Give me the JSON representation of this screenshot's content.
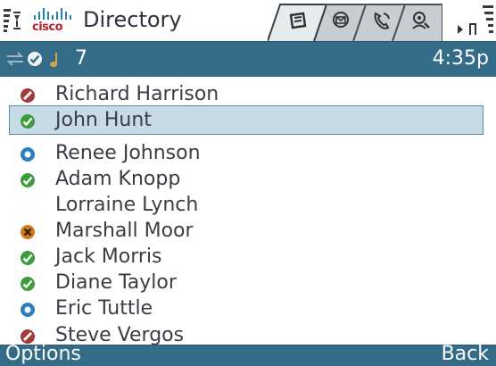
{
  "header": {
    "app_title": "Directory",
    "brand": "cisco",
    "tabs": [
      {
        "name": "contacts-card-icon",
        "active": true
      },
      {
        "name": "messages-icon",
        "active": false
      },
      {
        "name": "phone-call-icon",
        "active": false
      },
      {
        "name": "presence-search-icon",
        "active": false
      }
    ]
  },
  "status_bar": {
    "count": "7",
    "time": "4:35p",
    "icons": [
      "transfer-arrows-icon",
      "available-check-icon",
      "music-note-icon"
    ]
  },
  "contacts": [
    {
      "name": "Richard Harrison",
      "status": "busy",
      "selected": false
    },
    {
      "name": "John Hunt",
      "status": "available",
      "selected": true
    },
    {
      "name": "Renee Johnson",
      "status": "away",
      "selected": false
    },
    {
      "name": "Adam Knopp",
      "status": "available",
      "selected": false
    },
    {
      "name": "Lorraine Lynch",
      "status": "none",
      "selected": false
    },
    {
      "name": "Marshall Moor",
      "status": "dnd",
      "selected": false
    },
    {
      "name": "Jack Morris",
      "status": "available",
      "selected": false
    },
    {
      "name": "Diane Taylor",
      "status": "available",
      "selected": false
    },
    {
      "name": "Eric Tuttle",
      "status": "away",
      "selected": false
    },
    {
      "name": "Steve Vergos",
      "status": "busy",
      "selected": false
    }
  ],
  "softkeys": {
    "left": "Options",
    "right": "Back"
  },
  "colors": {
    "bar": "#346b87",
    "selection": "#c7dbe7",
    "available": "#3e9b3b",
    "busy": "#a33a3a",
    "away": "#2c7fbf",
    "dnd": "#d07a1e"
  }
}
